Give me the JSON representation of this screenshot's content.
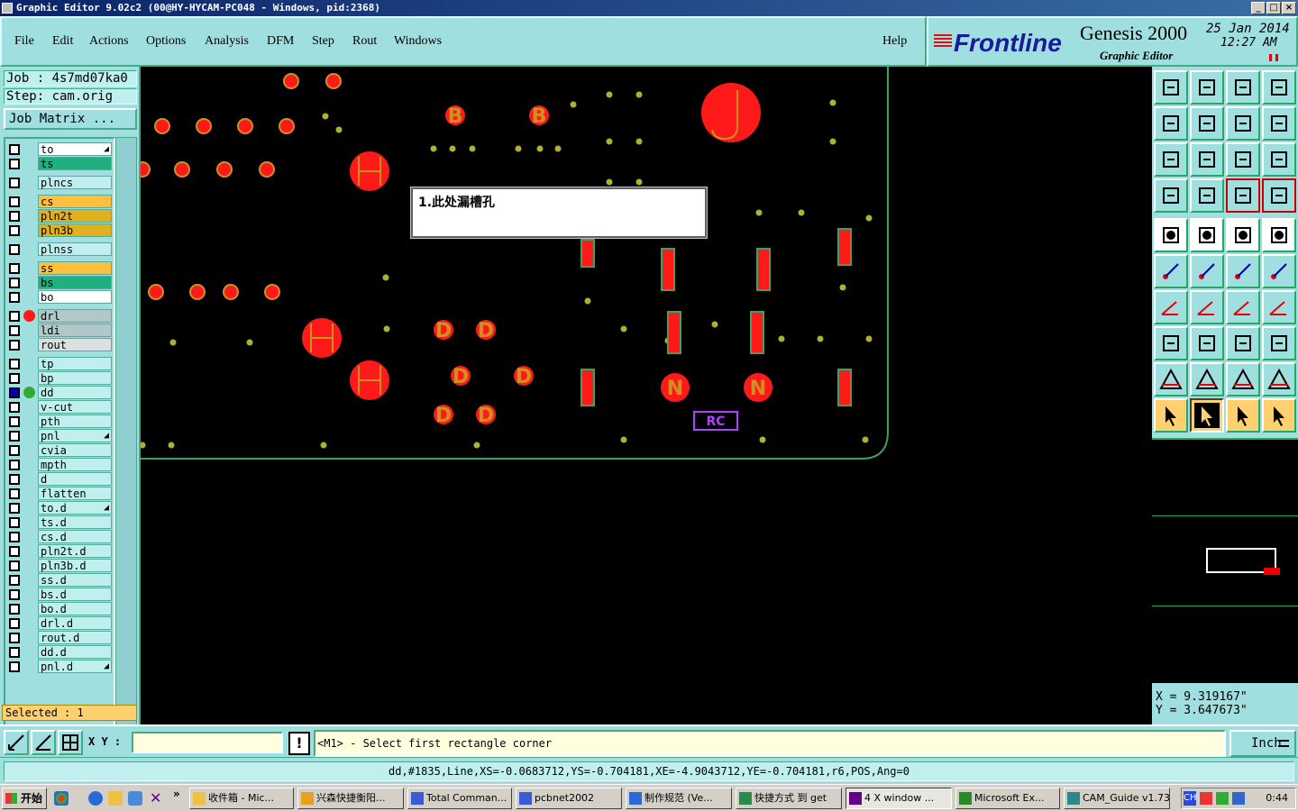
{
  "window": {
    "title": "Graphic Editor 9.02c2 (00@HY-HYCAM-PC048 - Windows, pid:2368)"
  },
  "menu": [
    "File",
    "Edit",
    "Actions",
    "Options",
    "Analysis",
    "DFM",
    "Step",
    "Rout",
    "Windows"
  ],
  "help_label": "Help",
  "brand": {
    "logo": "Frontline",
    "product": "Genesis 2000",
    "subtitle": "Graphic Editor",
    "date": "25 Jan 2014",
    "time": "12:27 AM"
  },
  "job": {
    "job_line": "Job : 4s7md07ka0",
    "step_line": "Step: cam.orig",
    "matrix_button": "Job Matrix ..."
  },
  "layers": [
    {
      "name": "to",
      "color": "#ffffff",
      "arrow": true
    },
    {
      "name": "ts",
      "color": "#20b080"
    },
    {
      "name": "plncs",
      "color": "#bfefef"
    },
    {
      "name": "cs",
      "color": "#ffc040"
    },
    {
      "name": "pln2t",
      "color": "#e0b020"
    },
    {
      "name": "pln3b",
      "color": "#e0b020"
    },
    {
      "name": "plnss",
      "color": "#bfefef"
    },
    {
      "name": "ss",
      "color": "#ffc040"
    },
    {
      "name": "bs",
      "color": "#20b080"
    },
    {
      "name": "bo",
      "color": "#ffffff"
    },
    {
      "name": "drl",
      "color": "#b0c8c8",
      "dot": true
    },
    {
      "name": "ldi",
      "color": "#b0c8c8"
    },
    {
      "name": "rout",
      "color": "#d8e0e0"
    },
    {
      "name": "tp",
      "color": "#bfefef"
    },
    {
      "name": "bp",
      "color": "#bfefef"
    },
    {
      "name": "dd",
      "color": "#bfefef",
      "work": true
    },
    {
      "name": "v-cut",
      "color": "#bfefef"
    },
    {
      "name": "pth",
      "color": "#bfefef"
    },
    {
      "name": "pnl",
      "color": "#bfefef",
      "arrow": true
    },
    {
      "name": "cvia",
      "color": "#bfefef"
    },
    {
      "name": "mpth",
      "color": "#bfefef"
    },
    {
      "name": "d",
      "color": "#bfefef"
    },
    {
      "name": "flatten",
      "color": "#bfefef"
    },
    {
      "name": "to.d",
      "color": "#bfefef",
      "arrow": true
    },
    {
      "name": "ts.d",
      "color": "#bfefef"
    },
    {
      "name": "cs.d",
      "color": "#bfefef"
    },
    {
      "name": "pln2t.d",
      "color": "#bfefef"
    },
    {
      "name": "pln3b.d",
      "color": "#bfefef"
    },
    {
      "name": "ss.d",
      "color": "#bfefef"
    },
    {
      "name": "bs.d",
      "color": "#bfefef"
    },
    {
      "name": "bo.d",
      "color": "#bfefef"
    },
    {
      "name": "drl.d",
      "color": "#bfefef"
    },
    {
      "name": "rout.d",
      "color": "#bfefef"
    },
    {
      "name": "dd.d",
      "color": "#bfefef"
    },
    {
      "name": "pnl.d",
      "color": "#bfefef",
      "arrow": true
    }
  ],
  "selected_text": "Selected : 1",
  "note_text": "1.此处漏槽孔",
  "canvas_label": "RC",
  "canvas_letters": [
    "B",
    "B",
    "D",
    "D",
    "D",
    "D",
    "D",
    "D",
    "N",
    "N"
  ],
  "coords": {
    "x": "X = 9.319167\"",
    "y": "Y = 3.647673\""
  },
  "cmd": {
    "xy_label": "X Y :",
    "xy_value": "",
    "bang": "!",
    "prompt": "<M1> - Select first rectangle corner",
    "units": "Inch"
  },
  "status_line": "dd,#1835,Line,XS=-0.0683712,YS=-0.704181,XE=-4.9043712,YE=-0.704181,r6,POS,Ang=0",
  "taskbar": {
    "start": "开始",
    "tasks": [
      "收件箱 - Mic...",
      "兴森快捷衡阳...",
      "Total Comman...",
      "pcbnet2002",
      "制作规范 (Ve...",
      "快捷方式 到 get",
      "4 X window ...",
      "Microsoft Ex...",
      "CAM_Guide v1.73"
    ],
    "clock": "0:44",
    "tray_label": "CH"
  },
  "colors": {
    "panel": "#9fdfdf",
    "pad": "#ff1a1a",
    "pad_outline": "#d09020",
    "via": "#b0b030",
    "outline": "#40a060"
  }
}
